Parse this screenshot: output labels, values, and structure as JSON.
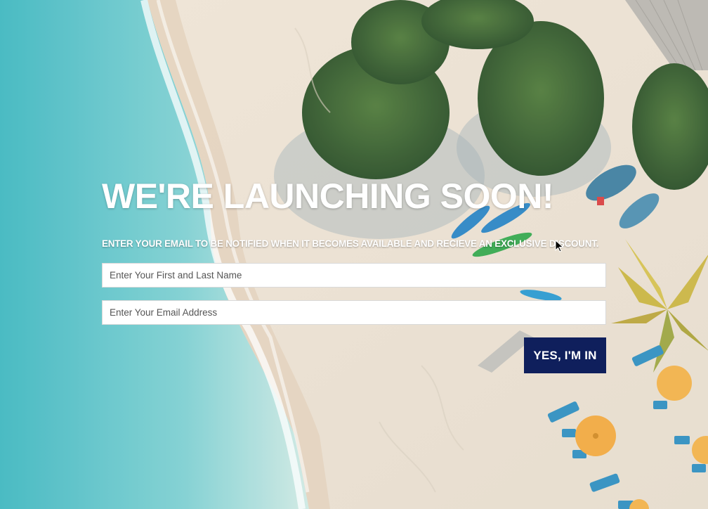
{
  "headline": "WE'RE LAUNCHING SOON!",
  "subheadline": "ENTER YOUR EMAIL TO BE NOTIFIED WHEN IT BECOMES AVAILABLE AND RECIEVE AN EXCLUSIVE DISCOUNT.",
  "form": {
    "name_placeholder": "Enter Your First and Last Name",
    "name_value": "",
    "email_placeholder": "Enter Your Email Address",
    "email_value": "",
    "submit_label": "YES, I'M IN"
  },
  "colors": {
    "button_bg": "#0f1f5c",
    "text": "#ffffff",
    "sea": "#5cc3c9",
    "sand": "#ece3d4"
  },
  "background": {
    "icon": "beach-aerial-photo"
  }
}
